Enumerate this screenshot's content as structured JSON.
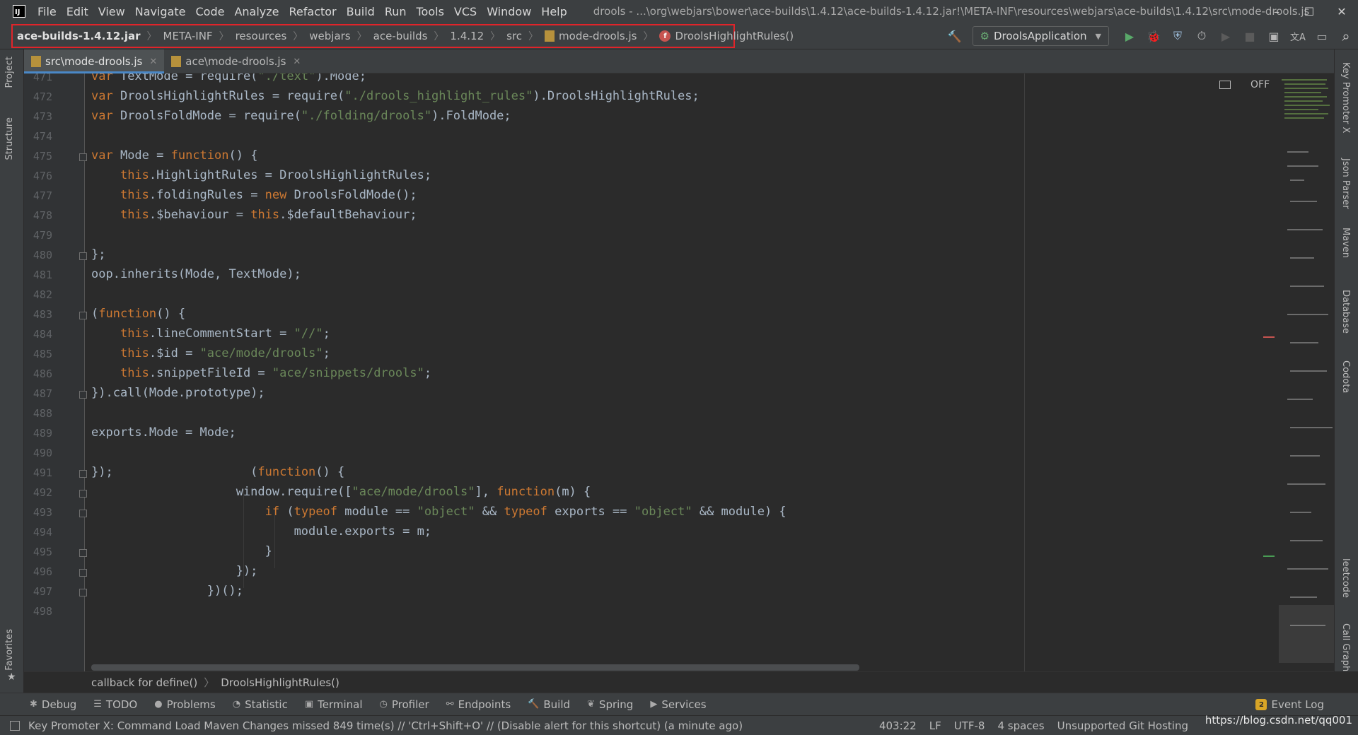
{
  "menubar": {
    "logo": "IJ",
    "items": [
      "File",
      "Edit",
      "View",
      "Navigate",
      "Code",
      "Analyze",
      "Refactor",
      "Build",
      "Run",
      "Tools",
      "VCS",
      "Window",
      "Help"
    ],
    "title": "drools - ...\\org\\webjars\\bower\\ace-builds\\1.4.12\\ace-builds-1.4.12.jar!\\META-INF\\resources\\webjars\\ace-builds\\1.4.12\\src\\mode-drools.js",
    "minimize": "–",
    "maximize": "☐",
    "close": "✕"
  },
  "breadcrumb": {
    "items": [
      "ace-builds-1.4.12.jar",
      "META-INF",
      "resources",
      "webjars",
      "ace-builds",
      "1.4.12",
      "src",
      "mode-drools.js",
      "DroolsHighlightRules()"
    ],
    "separator": "〉"
  },
  "toolbar": {
    "run_config": "DroolsApplication",
    "hammer": "🔨",
    "run": "▶",
    "debug": "🐞",
    "coverage": "⛨",
    "profile": "⏱",
    "stop": "■",
    "project_struct": "▣",
    "translate": "文A",
    "layout": "▭",
    "search": "⌕"
  },
  "left_strip": {
    "project": "Project",
    "structure": "Structure",
    "favorites": "Favorites"
  },
  "right_strip": {
    "key_promoter": "Key Promoter X",
    "json_parser": "Json Parser",
    "maven": "Maven",
    "database": "Database",
    "codota": "Codota",
    "leetcode": "leetcode",
    "call_graph": "Call Graph"
  },
  "tabs": [
    {
      "label": "src\\mode-drools.js",
      "active": true,
      "close": "✕"
    },
    {
      "label": "ace\\mode-drools.js",
      "active": false,
      "close": "✕"
    }
  ],
  "editor": {
    "reader_mode": "OFF",
    "line_numbers": [
      "471",
      "472",
      "473",
      "474",
      "475",
      "476",
      "477",
      "478",
      "479",
      "480",
      "481",
      "482",
      "483",
      "484",
      "485",
      "486",
      "487",
      "488",
      "489",
      "490",
      "491",
      "492",
      "493",
      "494",
      "495",
      "496",
      "497",
      "498"
    ]
  },
  "code_crumbs": {
    "items": [
      "callback for define()",
      "DroolsHighlightRules()"
    ],
    "separator": "〉"
  },
  "tool_windows": [
    {
      "label": "Debug",
      "icon": "✱"
    },
    {
      "label": "TODO",
      "icon": "☰"
    },
    {
      "label": "Problems",
      "icon": "●"
    },
    {
      "label": "Statistic",
      "icon": "◔"
    },
    {
      "label": "Terminal",
      "icon": "▣"
    },
    {
      "label": "Profiler",
      "icon": "◷"
    },
    {
      "label": "Endpoints",
      "icon": "⚯"
    },
    {
      "label": "Build",
      "icon": "🔨"
    },
    {
      "label": "Spring",
      "icon": "❦"
    },
    {
      "label": "Services",
      "icon": "▶"
    }
  ],
  "event_log": {
    "label": "Event Log",
    "badge": "2"
  },
  "statusbar": {
    "message": "Key Promoter X: Command Load Maven Changes missed 849 time(s) // 'Ctrl+Shift+O' // (Disable alert for this shortcut) (a minute ago)",
    "position": "403:22",
    "line_sep": "LF",
    "encoding": "UTF-8",
    "indent": "4 spaces",
    "git": "Unsupported Git Hosting"
  },
  "watermark": "https://blog.csdn.net/qq001",
  "colors": {
    "keyword": "#cc7832",
    "string": "#6a8759",
    "function": "#ffc66d",
    "text": "#a9b7c6",
    "highlight_border": "#e0242a",
    "active_tab_indicator": "#4a88c7"
  }
}
